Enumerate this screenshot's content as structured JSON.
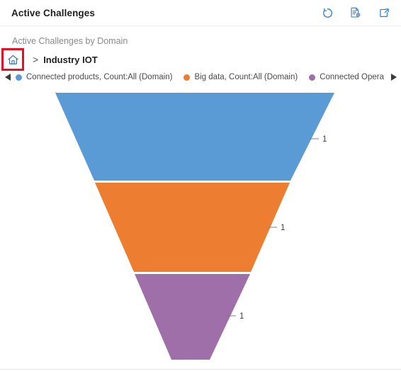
{
  "header": {
    "title": "Active Challenges",
    "actions": [
      {
        "name": "refresh-icon",
        "label": "Refresh"
      },
      {
        "name": "export-icon",
        "label": "Export"
      },
      {
        "name": "popout-icon",
        "label": "Expand"
      }
    ]
  },
  "chart": {
    "subtitle": "Active Challenges by Domain",
    "breadcrumb": {
      "home_label": "Home",
      "separator": ">",
      "current": "Industry IOT"
    },
    "legend": {
      "prev_arrow": "◀",
      "next_arrow": "▶",
      "items": [
        {
          "label": "Connected products, Count:All (Domain)",
          "color": "#5B9BD5"
        },
        {
          "label": "Big data, Count:All (Domain)",
          "color": "#ED7D31"
        },
        {
          "label": "Connected Opera",
          "color": "#9E6FA8"
        }
      ]
    }
  },
  "chart_data": {
    "type": "funnel",
    "title": "Active Challenges by Domain",
    "xlabel": "",
    "ylabel": "Count:All (Domain)",
    "categories": [
      "Connected products, Count:All (Domain)",
      "Big data, Count:All (Domain)",
      "Connected Opera"
    ],
    "values": [
      1,
      1,
      1
    ],
    "labels": [
      "1",
      "1",
      "1"
    ],
    "colors": [
      "#5B9BD5",
      "#ED7D31",
      "#9E6FA8"
    ],
    "legend_position": "top",
    "grid": false,
    "series": [
      {
        "name": "Count:All (Domain)",
        "values": [
          1,
          1,
          1
        ]
      }
    ]
  }
}
